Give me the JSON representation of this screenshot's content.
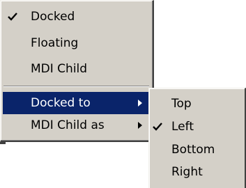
{
  "main_menu": {
    "items": [
      {
        "label": "Docked",
        "checked": true
      },
      {
        "label": "Floating",
        "checked": false
      },
      {
        "label": "MDI Child",
        "checked": false
      }
    ],
    "submenu_items": [
      {
        "label": "Docked to",
        "highlighted": true
      },
      {
        "label": "MDI Child as",
        "highlighted": false
      }
    ]
  },
  "docked_to_submenu": {
    "items": [
      {
        "label": "Top",
        "checked": false
      },
      {
        "label": "Left",
        "checked": true
      },
      {
        "label": "Bottom",
        "checked": false
      },
      {
        "label": "Right",
        "checked": false
      }
    ]
  },
  "colors": {
    "menu_face": "#d4d0c8",
    "highlight": "#0a246a",
    "highlight_text": "#ffffff"
  },
  "icons": {
    "check": "check-icon",
    "submenu_arrow": "submenu-arrow-icon"
  }
}
